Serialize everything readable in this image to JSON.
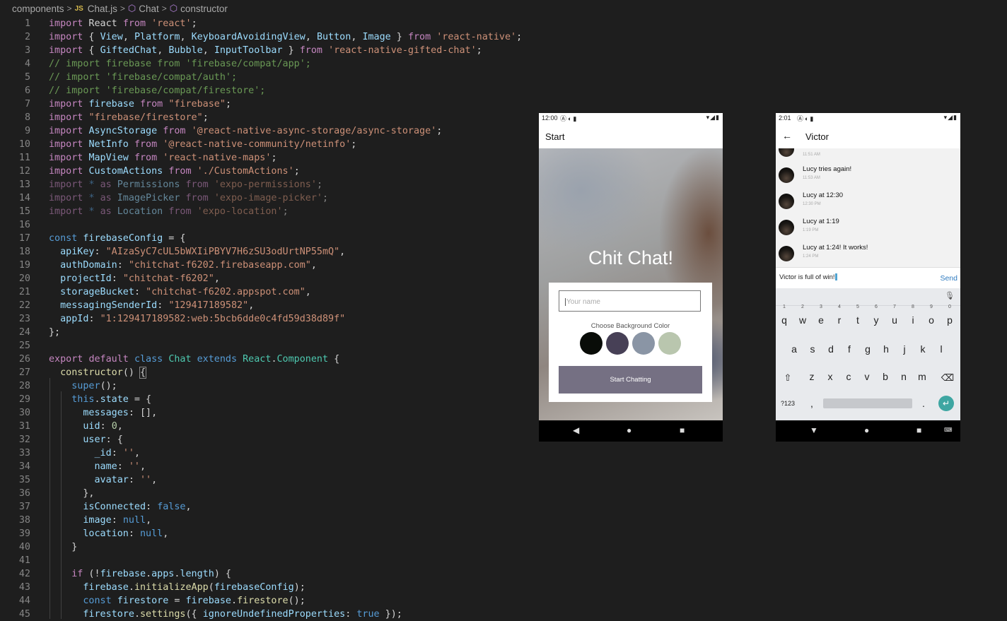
{
  "breadcrumb": {
    "items": [
      "components",
      "JS",
      "Chat.js",
      "Chat",
      "constructor"
    ]
  },
  "code": [
    [
      {
        "c": "kw",
        "t": "import"
      },
      {
        "t": " React "
      },
      {
        "c": "kw",
        "t": "from"
      },
      {
        "t": " "
      },
      {
        "c": "str",
        "t": "'react'"
      },
      {
        "t": ";"
      }
    ],
    [
      {
        "c": "kw",
        "t": "import"
      },
      {
        "t": " { "
      },
      {
        "c": "var",
        "t": "View"
      },
      {
        "t": ", "
      },
      {
        "c": "var",
        "t": "Platform"
      },
      {
        "t": ", "
      },
      {
        "c": "var",
        "t": "KeyboardAvoidingView"
      },
      {
        "t": ", "
      },
      {
        "c": "var",
        "t": "Button"
      },
      {
        "t": ", "
      },
      {
        "c": "var",
        "t": "Image"
      },
      {
        "t": " } "
      },
      {
        "c": "kw",
        "t": "from"
      },
      {
        "t": " "
      },
      {
        "c": "str",
        "t": "'react-native'"
      },
      {
        "t": ";"
      }
    ],
    [
      {
        "c": "kw",
        "t": "import"
      },
      {
        "t": " { "
      },
      {
        "c": "var",
        "t": "GiftedChat"
      },
      {
        "t": ", "
      },
      {
        "c": "var",
        "t": "Bubble"
      },
      {
        "t": ", "
      },
      {
        "c": "var",
        "t": "InputToolbar"
      },
      {
        "t": " } "
      },
      {
        "c": "kw",
        "t": "from"
      },
      {
        "t": " "
      },
      {
        "c": "str",
        "t": "'react-native-gifted-chat'"
      },
      {
        "t": ";"
      }
    ],
    [
      {
        "c": "cm",
        "t": "// import firebase from 'firebase/compat/app';"
      }
    ],
    [
      {
        "c": "cm",
        "t": "// import 'firebase/compat/auth';"
      }
    ],
    [
      {
        "c": "cm",
        "t": "// import 'firebase/compat/firestore';"
      }
    ],
    [
      {
        "c": "kw",
        "t": "import"
      },
      {
        "t": " "
      },
      {
        "c": "var",
        "t": "firebase"
      },
      {
        "t": " "
      },
      {
        "c": "kw",
        "t": "from"
      },
      {
        "t": " "
      },
      {
        "c": "str",
        "t": "\"firebase\""
      },
      {
        "t": ";"
      }
    ],
    [
      {
        "c": "kw",
        "t": "import"
      },
      {
        "t": " "
      },
      {
        "c": "str",
        "t": "\"firebase/firestore\""
      },
      {
        "t": ";"
      }
    ],
    [
      {
        "c": "kw",
        "t": "import"
      },
      {
        "t": " "
      },
      {
        "c": "var",
        "t": "AsyncStorage"
      },
      {
        "t": " "
      },
      {
        "c": "kw",
        "t": "from"
      },
      {
        "t": " "
      },
      {
        "c": "str",
        "t": "'@react-native-async-storage/async-storage'"
      },
      {
        "t": ";"
      }
    ],
    [
      {
        "c": "kw",
        "t": "import"
      },
      {
        "t": " "
      },
      {
        "c": "var",
        "t": "NetInfo"
      },
      {
        "t": " "
      },
      {
        "c": "kw",
        "t": "from"
      },
      {
        "t": " "
      },
      {
        "c": "str",
        "t": "'@react-native-community/netinfo'"
      },
      {
        "t": ";"
      }
    ],
    [
      {
        "c": "kw",
        "t": "import"
      },
      {
        "t": " "
      },
      {
        "c": "var",
        "t": "MapView"
      },
      {
        "t": " "
      },
      {
        "c": "kw",
        "t": "from"
      },
      {
        "t": " "
      },
      {
        "c": "str",
        "t": "'react-native-maps'"
      },
      {
        "t": ";"
      }
    ],
    [
      {
        "c": "kw",
        "t": "import"
      },
      {
        "t": " "
      },
      {
        "c": "var",
        "t": "CustomActions"
      },
      {
        "t": " "
      },
      {
        "c": "kw",
        "t": "from"
      },
      {
        "t": " "
      },
      {
        "c": "str",
        "t": "'./CustomActions'"
      },
      {
        "t": ";"
      }
    ],
    [
      {
        "c": "kw dim",
        "t": "import"
      },
      {
        "c": "dim",
        "t": " "
      },
      {
        "c": "kb dim",
        "t": "*"
      },
      {
        "c": "dim",
        "t": " "
      },
      {
        "c": "kw dim",
        "t": "as"
      },
      {
        "c": "dim",
        "t": " "
      },
      {
        "c": "var dim",
        "t": "Permissions"
      },
      {
        "c": "dim",
        "t": " "
      },
      {
        "c": "kw dim",
        "t": "from"
      },
      {
        "c": "dim",
        "t": " "
      },
      {
        "c": "str dim",
        "t": "'expo-permissions'"
      },
      {
        "c": "dim",
        "t": ";"
      }
    ],
    [
      {
        "c": "kw dim",
        "t": "import"
      },
      {
        "c": "dim",
        "t": " "
      },
      {
        "c": "kb dim",
        "t": "*"
      },
      {
        "c": "dim",
        "t": " "
      },
      {
        "c": "kw dim",
        "t": "as"
      },
      {
        "c": "dim",
        "t": " "
      },
      {
        "c": "var dim",
        "t": "ImagePicker"
      },
      {
        "c": "dim",
        "t": " "
      },
      {
        "c": "kw dim",
        "t": "from"
      },
      {
        "c": "dim",
        "t": " "
      },
      {
        "c": "str dim",
        "t": "'expo-image-picker'"
      },
      {
        "c": "dim",
        "t": ";"
      }
    ],
    [
      {
        "c": "kw dim",
        "t": "import"
      },
      {
        "c": "dim",
        "t": " "
      },
      {
        "c": "kb dim",
        "t": "*"
      },
      {
        "c": "dim",
        "t": " "
      },
      {
        "c": "kw dim",
        "t": "as"
      },
      {
        "c": "dim",
        "t": " "
      },
      {
        "c": "var dim",
        "t": "Location"
      },
      {
        "c": "dim",
        "t": " "
      },
      {
        "c": "kw dim",
        "t": "from"
      },
      {
        "c": "dim",
        "t": " "
      },
      {
        "c": "str dim",
        "t": "'expo-location'"
      },
      {
        "c": "dim",
        "t": ";"
      }
    ],
    [],
    [
      {
        "c": "kb",
        "t": "const"
      },
      {
        "t": " "
      },
      {
        "c": "var",
        "t": "firebaseConfig"
      },
      {
        "t": " = {"
      }
    ],
    [
      {
        "t": "  "
      },
      {
        "c": "var",
        "t": "apiKey"
      },
      {
        "t": ": "
      },
      {
        "c": "str",
        "t": "\"AIzaSyC7cUL5bWXIiPBYV7H6zSU3odUrtNP55mQ\""
      },
      {
        "t": ","
      }
    ],
    [
      {
        "t": "  "
      },
      {
        "c": "var",
        "t": "authDomain"
      },
      {
        "t": ": "
      },
      {
        "c": "str",
        "t": "\"chitchat-f6202.firebaseapp.com\""
      },
      {
        "t": ","
      }
    ],
    [
      {
        "t": "  "
      },
      {
        "c": "var",
        "t": "projectId"
      },
      {
        "t": ": "
      },
      {
        "c": "str",
        "t": "\"chitchat-f6202\""
      },
      {
        "t": ","
      }
    ],
    [
      {
        "t": "  "
      },
      {
        "c": "var",
        "t": "storageBucket"
      },
      {
        "t": ": "
      },
      {
        "c": "str",
        "t": "\"chitchat-f6202.appspot.com\""
      },
      {
        "t": ","
      }
    ],
    [
      {
        "t": "  "
      },
      {
        "c": "var",
        "t": "messagingSenderId"
      },
      {
        "t": ": "
      },
      {
        "c": "str",
        "t": "\"129417189582\""
      },
      {
        "t": ","
      }
    ],
    [
      {
        "t": "  "
      },
      {
        "c": "var",
        "t": "appId"
      },
      {
        "t": ": "
      },
      {
        "c": "str",
        "t": "\"1:129417189582:web:5bcb6dde0c4fd59d38d89f\""
      }
    ],
    [
      {
        "t": "};"
      }
    ],
    [],
    [
      {
        "c": "kw",
        "t": "export"
      },
      {
        "t": " "
      },
      {
        "c": "kw",
        "t": "default"
      },
      {
        "t": " "
      },
      {
        "c": "kb",
        "t": "class"
      },
      {
        "t": " "
      },
      {
        "c": "cls",
        "t": "Chat"
      },
      {
        "t": " "
      },
      {
        "c": "kb",
        "t": "extends"
      },
      {
        "t": " "
      },
      {
        "c": "cls",
        "t": "React"
      },
      {
        "t": "."
      },
      {
        "c": "cls",
        "t": "Component"
      },
      {
        "t": " {"
      }
    ],
    [
      {
        "t": "  "
      },
      {
        "c": "fn",
        "t": "constructor"
      },
      {
        "t": "() "
      },
      {
        "c": "bracket",
        "t": "{"
      }
    ],
    [
      {
        "t": "    "
      },
      {
        "c": "kb",
        "t": "super"
      },
      {
        "t": "();"
      }
    ],
    [
      {
        "t": "    "
      },
      {
        "c": "kb",
        "t": "this"
      },
      {
        "t": "."
      },
      {
        "c": "var",
        "t": "state"
      },
      {
        "t": " = {"
      }
    ],
    [
      {
        "t": "      "
      },
      {
        "c": "var",
        "t": "messages"
      },
      {
        "t": ": [],"
      }
    ],
    [
      {
        "t": "      "
      },
      {
        "c": "var",
        "t": "uid"
      },
      {
        "t": ": "
      },
      {
        "c": "num",
        "t": "0"
      },
      {
        "t": ","
      }
    ],
    [
      {
        "t": "      "
      },
      {
        "c": "var",
        "t": "user"
      },
      {
        "t": ": {"
      }
    ],
    [
      {
        "t": "        "
      },
      {
        "c": "var",
        "t": "_id"
      },
      {
        "t": ": "
      },
      {
        "c": "str",
        "t": "''"
      },
      {
        "t": ","
      }
    ],
    [
      {
        "t": "        "
      },
      {
        "c": "var",
        "t": "name"
      },
      {
        "t": ": "
      },
      {
        "c": "str",
        "t": "''"
      },
      {
        "t": ","
      }
    ],
    [
      {
        "t": "        "
      },
      {
        "c": "var",
        "t": "avatar"
      },
      {
        "t": ": "
      },
      {
        "c": "str",
        "t": "''"
      },
      {
        "t": ","
      }
    ],
    [
      {
        "t": "      },"
      }
    ],
    [
      {
        "t": "      "
      },
      {
        "c": "var",
        "t": "isConnected"
      },
      {
        "t": ": "
      },
      {
        "c": "kb",
        "t": "false"
      },
      {
        "t": ","
      }
    ],
    [
      {
        "t": "      "
      },
      {
        "c": "var",
        "t": "image"
      },
      {
        "t": ": "
      },
      {
        "c": "kb",
        "t": "null"
      },
      {
        "t": ","
      }
    ],
    [
      {
        "t": "      "
      },
      {
        "c": "var",
        "t": "location"
      },
      {
        "t": ": "
      },
      {
        "c": "kb",
        "t": "null"
      },
      {
        "t": ","
      }
    ],
    [
      {
        "t": "    }"
      }
    ],
    [],
    [
      {
        "t": "    "
      },
      {
        "c": "kw",
        "t": "if"
      },
      {
        "t": " (!"
      },
      {
        "c": "var",
        "t": "firebase"
      },
      {
        "t": "."
      },
      {
        "c": "var",
        "t": "apps"
      },
      {
        "t": "."
      },
      {
        "c": "var",
        "t": "length"
      },
      {
        "t": ") {"
      }
    ],
    [
      {
        "t": "      "
      },
      {
        "c": "var",
        "t": "firebase"
      },
      {
        "t": "."
      },
      {
        "c": "fn",
        "t": "initializeApp"
      },
      {
        "t": "("
      },
      {
        "c": "var",
        "t": "firebaseConfig"
      },
      {
        "t": ");"
      }
    ],
    [
      {
        "t": "      "
      },
      {
        "c": "kb",
        "t": "const"
      },
      {
        "t": " "
      },
      {
        "c": "var",
        "t": "firestore"
      },
      {
        "t": " = "
      },
      {
        "c": "var",
        "t": "firebase"
      },
      {
        "t": "."
      },
      {
        "c": "fn",
        "t": "firestore"
      },
      {
        "t": "();"
      }
    ],
    [
      {
        "t": "      "
      },
      {
        "c": "var",
        "t": "firestore"
      },
      {
        "t": "."
      },
      {
        "c": "fn",
        "t": "settings"
      },
      {
        "t": "({ "
      },
      {
        "c": "var",
        "t": "ignoreUndefinedProperties"
      },
      {
        "t": ": "
      },
      {
        "c": "kb",
        "t": "true"
      },
      {
        "t": " });"
      }
    ]
  ],
  "phone1": {
    "time": "12:00",
    "title": "Start",
    "heading": "Chit Chat!",
    "placeholder": "Your name",
    "choose_label": "Choose Background Color",
    "colors": [
      "#090C08",
      "#474056",
      "#8A95A5",
      "#B9C6AE"
    ],
    "button": "Start Chatting"
  },
  "phone2": {
    "time": "2:01",
    "title": "Victor",
    "top_ts": "11:51 AM",
    "messages": [
      {
        "text": "Lucy tries again!",
        "time": "11:53 AM"
      },
      {
        "text": "Lucy at 12:30",
        "time": "12:30 PM"
      },
      {
        "text": "Lucy at 1:19",
        "time": "1:19 PM"
      },
      {
        "text": "Lucy at 1:24! It works!",
        "time": "1:24 PM"
      }
    ],
    "compose": "Victor is full of win!",
    "send": "Send",
    "keys_row1": [
      "q",
      "w",
      "e",
      "r",
      "t",
      "y",
      "u",
      "i",
      "o",
      "p"
    ],
    "nums_row1": [
      "1",
      "2",
      "3",
      "4",
      "5",
      "6",
      "7",
      "8",
      "9",
      "0"
    ],
    "keys_row2": [
      "a",
      "s",
      "d",
      "f",
      "g",
      "h",
      "j",
      "k",
      "l"
    ],
    "keys_row3": [
      "z",
      "x",
      "c",
      "v",
      "b",
      "n",
      "m"
    ],
    "sym_key": "?123",
    "comma_key": ",",
    "period_key": "."
  }
}
